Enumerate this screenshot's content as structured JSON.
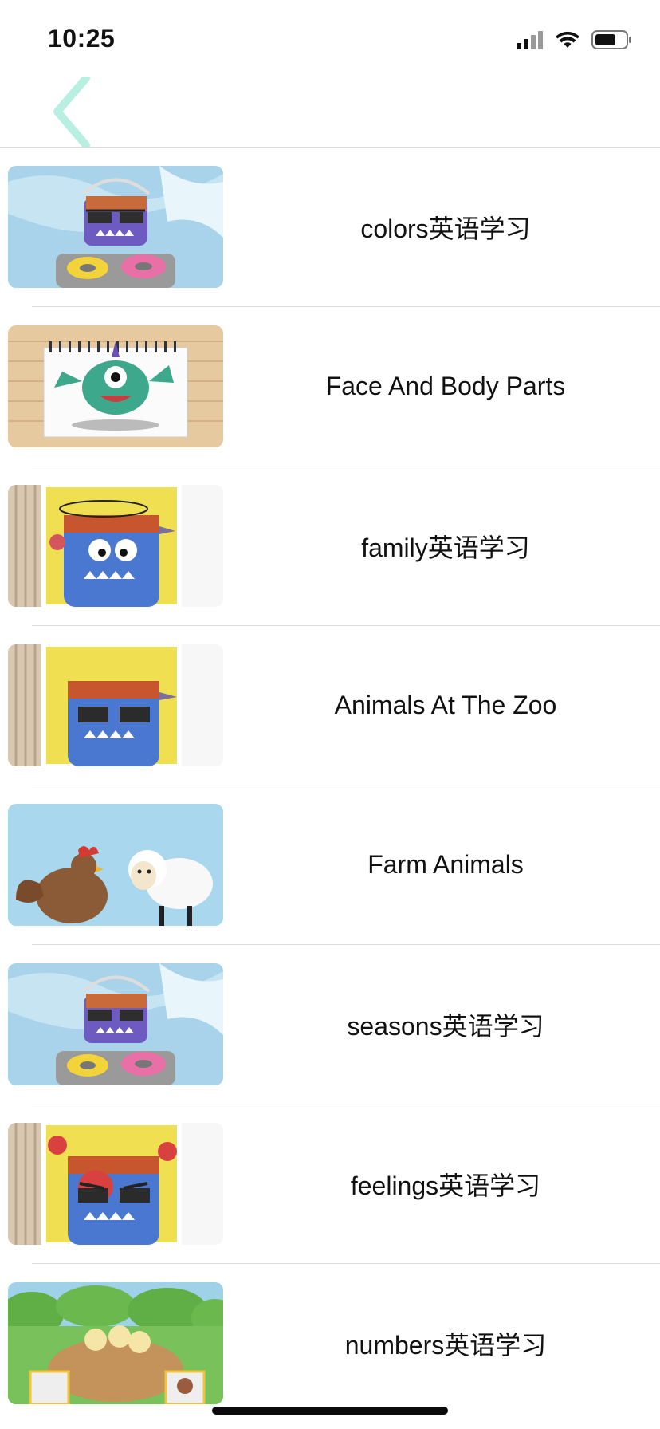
{
  "status": {
    "time": "10:25"
  },
  "nav": {
    "back_label": ""
  },
  "lessons": [
    {
      "title": "colors英语学习",
      "thumb": "dj-monster"
    },
    {
      "title": "Face And Body Parts",
      "thumb": "notepad-monster"
    },
    {
      "title": "family英语学习",
      "thumb": "dizzy-monster"
    },
    {
      "title": "Animals At The Zoo",
      "thumb": "sunglasses-monster"
    },
    {
      "title": "Farm Animals",
      "thumb": "hen-and-sheep"
    },
    {
      "title": "seasons英语学习",
      "thumb": "dj-monster"
    },
    {
      "title": "feelings英语学习",
      "thumb": "angry-monster"
    },
    {
      "title": "numbers英语学习",
      "thumb": "chicks-nest"
    }
  ],
  "colors": {
    "accent": "#b8efe2",
    "separator": "#dcdcdc"
  }
}
